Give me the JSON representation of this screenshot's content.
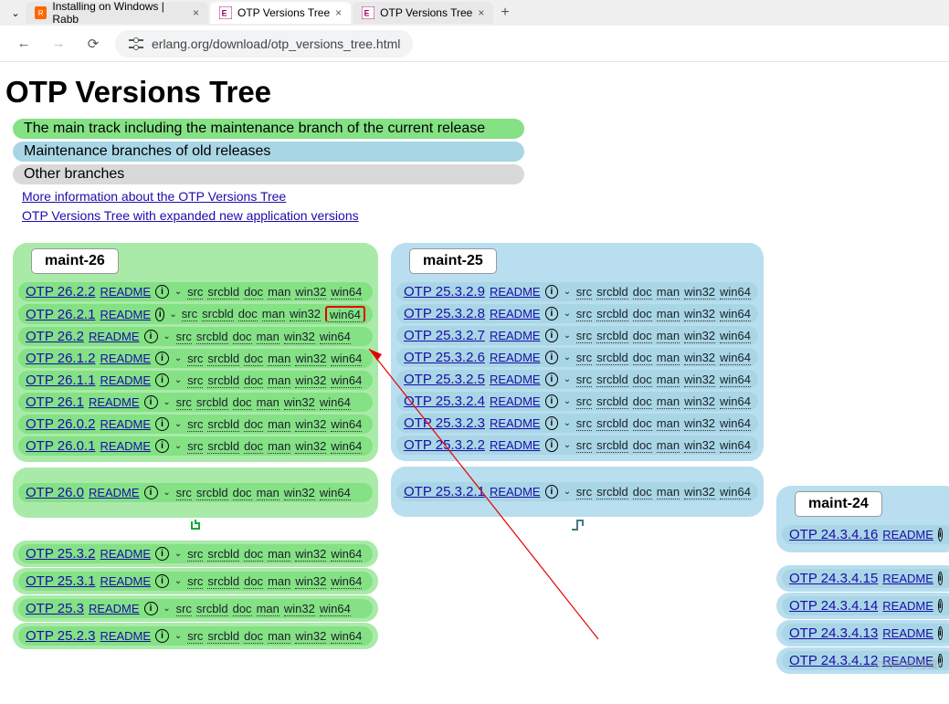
{
  "tabs": [
    {
      "title": "Installing on Windows | Rabb"
    },
    {
      "title": "OTP Versions Tree"
    },
    {
      "title": "OTP Versions Tree"
    }
  ],
  "url": "erlang.org/download/otp_versions_tree.html",
  "page_title": "OTP Versions Tree",
  "legend": {
    "green": "The main track including the maintenance branch of the current release",
    "blue": "Maintenance branches of old releases",
    "grey": "Other branches"
  },
  "links": {
    "more_info": "More information about the OTP Versions Tree",
    "expanded": "OTP Versions Tree with expanded new application versions"
  },
  "labels": {
    "readme": "README",
    "src": "src",
    "srcbld": "srcbld",
    "doc": "doc",
    "man": "man",
    "win32": "win32",
    "win64": "win64"
  },
  "branches": {
    "maint26": {
      "label": "maint-26",
      "versions": [
        "OTP 26.2.2",
        "OTP 26.2.1",
        "OTP 26.2",
        "OTP 26.1.2",
        "OTP 26.1.1",
        "OTP 26.1",
        "OTP 26.0.2",
        "OTP 26.0.1"
      ],
      "last": "OTP 26.0",
      "extra": [
        "OTP 25.3.2",
        "OTP 25.3.1",
        "OTP 25.3",
        "OTP 25.2.3"
      ]
    },
    "maint25": {
      "label": "maint-25",
      "versions": [
        "OTP 25.3.2.9",
        "OTP 25.3.2.8",
        "OTP 25.3.2.7",
        "OTP 25.3.2.6",
        "OTP 25.3.2.5",
        "OTP 25.3.2.4",
        "OTP 25.3.2.3",
        "OTP 25.3.2.2"
      ],
      "last": "OTP 25.3.2.1"
    },
    "maint24": {
      "label": "maint-24",
      "top": "OTP 24.3.4.16",
      "versions": [
        "OTP 24.3.4.15",
        "OTP 24.3.4.14",
        "OTP 24.3.4.13",
        "OTP 24.3.4.12"
      ]
    }
  },
  "watermark": "CSDN @ 考拉n"
}
